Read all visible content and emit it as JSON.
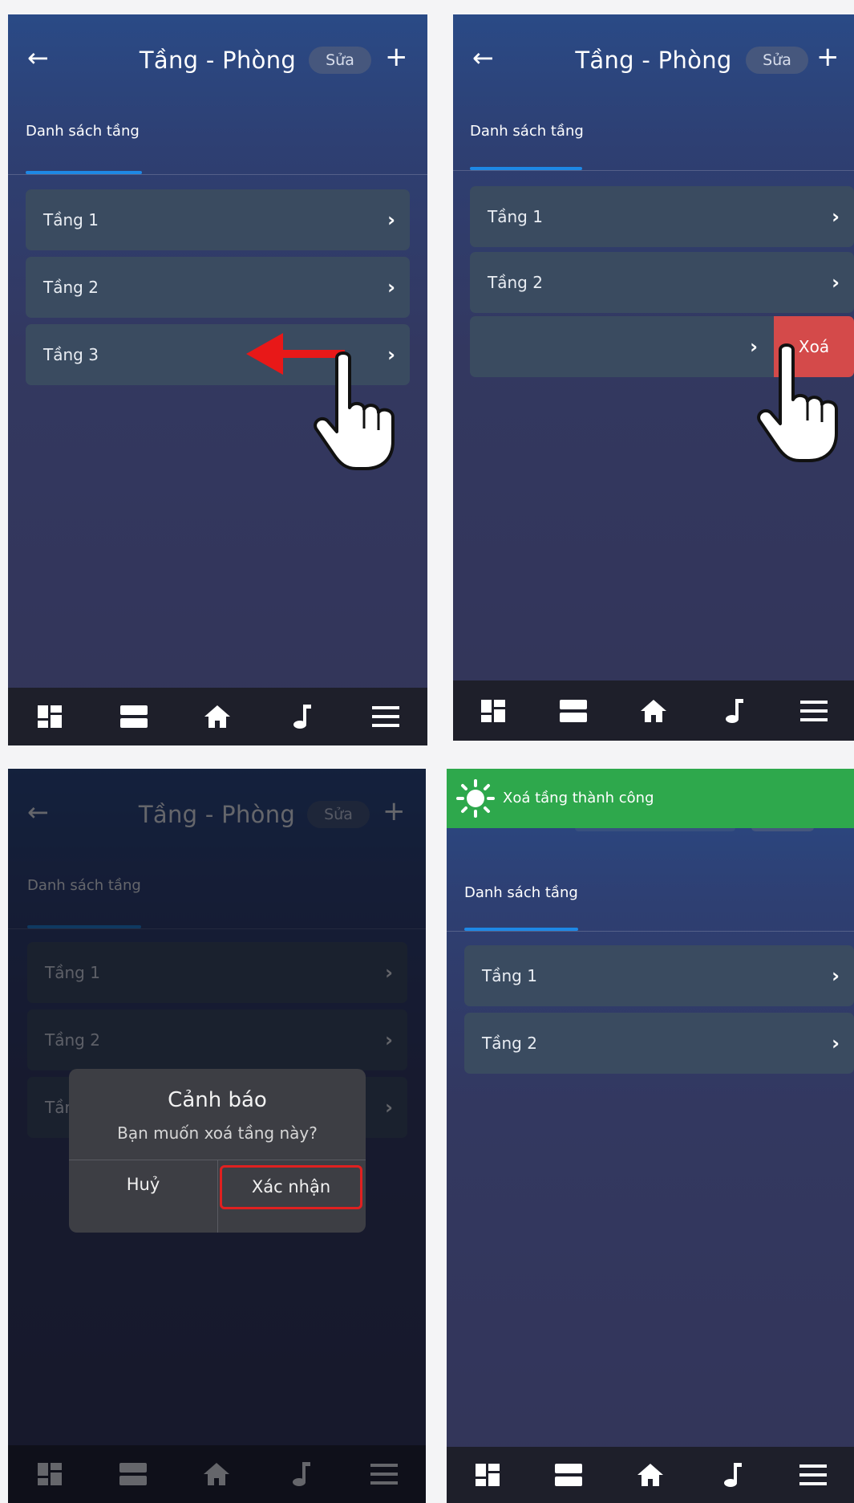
{
  "header": {
    "back_icon": "arrow-left-icon",
    "title": "Tầng - Phòng",
    "edit_label": "Sửa",
    "add_icon": "plus-icon"
  },
  "tab": {
    "label": "Danh sách tầng"
  },
  "floors": [
    "Tầng 1",
    "Tầng 2",
    "Tầng 3"
  ],
  "swipe_action": {
    "delete_label": "Xoá"
  },
  "dialog": {
    "title": "Cảnh báo",
    "message": "Bạn muốn xoá tầng này?",
    "cancel_label": "Huỷ",
    "confirm_label": "Xác nhận"
  },
  "toast": {
    "message": "Xoá tầng thành công",
    "icon": "sun-icon"
  },
  "bottom_nav": [
    "dashboard-icon",
    "layers-icon",
    "home-icon",
    "music-note-icon",
    "menu-icon"
  ],
  "annotations": {
    "swipe_arrow": "red-left-arrow-icon",
    "pointer": "hand-pointer-icon"
  },
  "colors": {
    "tab_indicator": "#1e88e5",
    "delete": "#d44a4a",
    "toast": "#2ea84c",
    "confirm_border": "#e02020"
  }
}
